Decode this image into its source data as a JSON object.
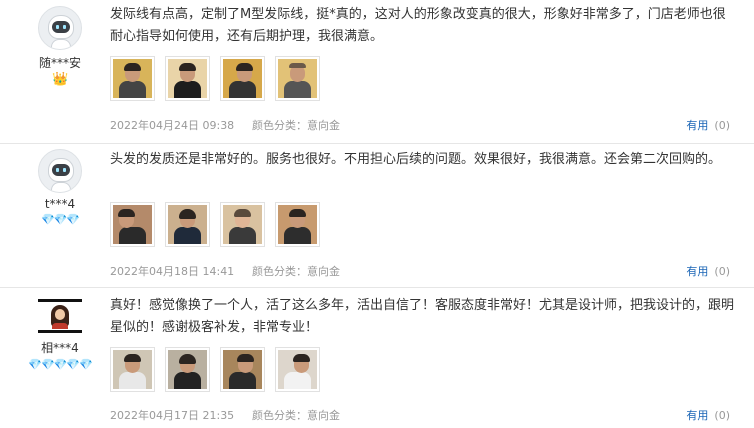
{
  "reviews": [
    {
      "username": "随***安",
      "badge_icons": [
        "crown-icon"
      ],
      "badge_text": "👑",
      "text": "发际线有点高，定制了M型发际线，挺*真的，这对人的形象改变真的很大，形象好非常多了，门店老师也很耐心指导如何使用，还有后期护理，我很满意。",
      "photo_count": 4,
      "date": "2022年04月24日 09:38",
      "variant": "颜色分类：意向金",
      "useful_label": "有用",
      "useful_count": "(0)"
    },
    {
      "username": "t***4",
      "badge_icons": [
        "diamond-icon",
        "diamond-icon",
        "diamond-icon"
      ],
      "badge_text": "💎💎💎",
      "text": "头发的发质还是非常好的。服务也很好。不用担心后续的问题。效果很好，我很满意。还会第二次回购的。",
      "photo_count": 4,
      "date": "2022年04月18日 14:41",
      "variant": "颜色分类：意向金",
      "useful_label": "有用",
      "useful_count": "(0)"
    },
    {
      "username": "相***4",
      "badge_icons": [
        "diamond-icon",
        "diamond-icon",
        "diamond-icon",
        "diamond-icon",
        "diamond-icon"
      ],
      "badge_text": "💎💎💎💎💎",
      "text": "真好！感觉像换了一个人，活了这么多年，活出自信了！客服态度非常好！尤其是设计师，把我设计的，跟明星似的！感谢极客补发，非常专业！",
      "photo_count": 4,
      "date": "2022年04月17日 21:35",
      "variant": "颜色分类：意向金",
      "useful_label": "有用",
      "useful_count": "(0)"
    }
  ],
  "colors": {
    "link": "#1a65b6",
    "meta": "#999999",
    "divider": "#e6e6e6"
  }
}
